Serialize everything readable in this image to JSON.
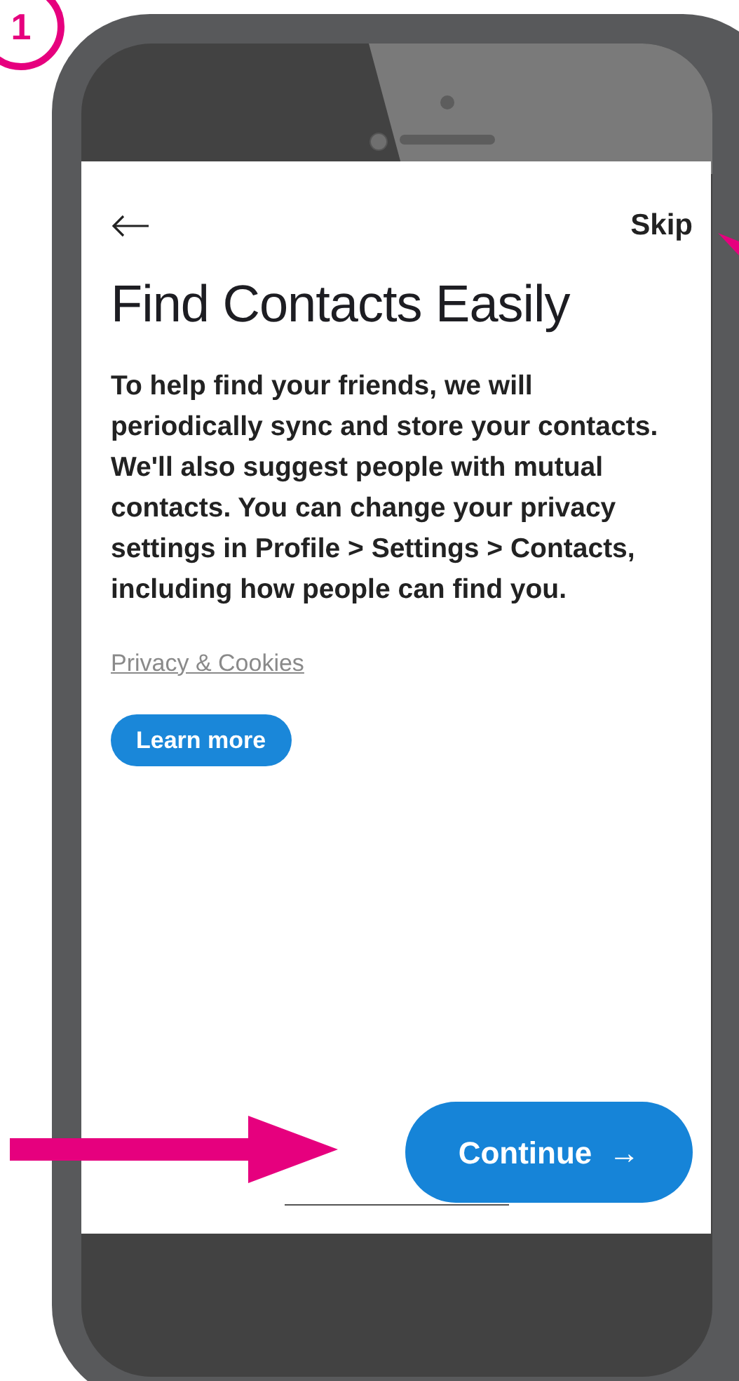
{
  "step_badge": "1",
  "nav": {
    "skip": "Skip"
  },
  "title": "Find Contacts Easily",
  "body": "To help find your friends, we will periodically sync and store your contacts. We'll also suggest people with mutual contacts. You can change your privacy settings in Profile > Settings > Contacts, including how people can find you.",
  "privacy_link": "Privacy & Cookies",
  "learn_more_button": "Learn more",
  "continue_button": {
    "label": "Continue",
    "arrow": "→"
  }
}
